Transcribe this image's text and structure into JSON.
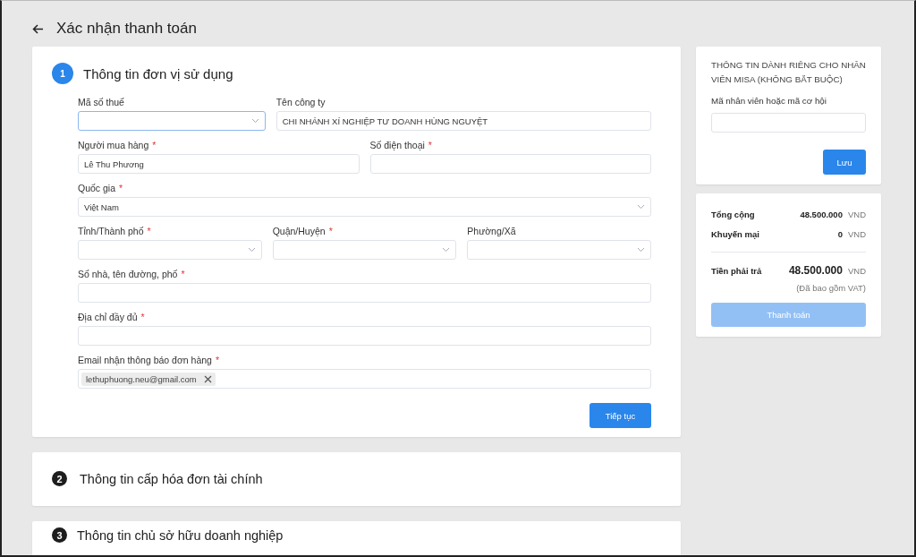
{
  "header": {
    "title": "Xác nhận thanh toán"
  },
  "steps": [
    {
      "number": "1",
      "title": "Thông tin đơn vị sử dụng",
      "active": true
    },
    {
      "number": "2",
      "title": "Thông tin cấp hóa đơn tài chính",
      "active": false
    },
    {
      "number": "3",
      "title": "Thông tin chủ sở hữu doanh nghiệp",
      "active": false
    }
  ],
  "form": {
    "rows": [
      [
        {
          "label": "Mã số thuế",
          "kind": "select",
          "focused": true
        },
        {
          "label": "Tên công ty",
          "kind": "text",
          "value": "CHI NHÁNH XÍ NGHIỆP TƯ DOANH HÙNG NGUYỆT",
          "focused": false
        }
      ],
      [
        {
          "label": "Người mua hàng",
          "required_mark": "*",
          "kind": "text",
          "value": "Lê Thu Phương",
          "focused": false
        },
        {
          "label": "Số điện thoại",
          "required_mark": "*",
          "kind": "text",
          "focused": false
        }
      ],
      [
        {
          "label": "Quốc gia",
          "required_mark": "*",
          "kind": "select",
          "value": "Việt Nam",
          "focused": false
        }
      ],
      [
        {
          "label": "Tỉnh/Thành phố",
          "required_mark": "*",
          "kind": "select",
          "focused": false
        },
        {
          "label": "Quận/Huyện",
          "required_mark": "*",
          "kind": "select",
          "focused": false
        },
        {
          "label": "Phường/Xã",
          "kind": "select",
          "focused": false
        }
      ],
      [
        {
          "label": "Số nhà, tên đường, phố",
          "required_mark": "*",
          "kind": "text",
          "focused": false
        }
      ],
      [
        {
          "label": "Địa chỉ đầy đủ",
          "required_mark": "*",
          "kind": "text",
          "focused": false
        }
      ],
      [
        {
          "label": "Email nhận thông báo đơn hàng",
          "required_mark": "*",
          "kind": "tags",
          "tags": [
            "lethuphuong.neu@gmail.com"
          ],
          "focused": false
        }
      ]
    ],
    "submit": "Tiếp tục"
  },
  "staff_panel": {
    "title": "THÔNG TIN DÀNH RIÊNG CHO NHÂN VIÊN MISA (KHÔNG BẮT BUỘC)",
    "field_label": "Mã nhân viên hoặc mã cơ hội",
    "save": "Lưu"
  },
  "summary": {
    "rows": [
      {
        "label": "Tổng cộng",
        "amount": "48.500.000",
        "currency": "VND",
        "kind": "line"
      },
      {
        "label": "Khuyến mại",
        "amount": "0",
        "currency": "VND",
        "kind": "line"
      },
      {
        "label": "Tiền phải trả",
        "amount": "48.500.000",
        "currency": "VND",
        "kind": "total"
      }
    ],
    "note": "(Đã bao gồm VAT)",
    "pay": "Thanh toán",
    "pay_disabled": true
  }
}
